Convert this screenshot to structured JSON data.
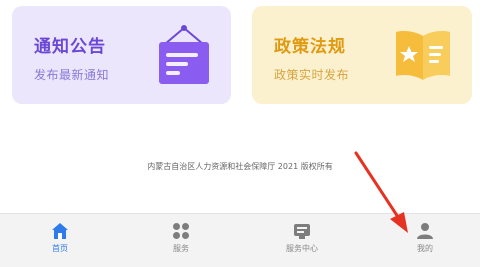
{
  "cards": [
    {
      "title": "通知公告",
      "subtitle": "发布最新通知",
      "icon": "notice-board-icon"
    },
    {
      "title": "政策法规",
      "subtitle": "政策实时发布",
      "icon": "policy-book-icon"
    }
  ],
  "footer": {
    "copyright": "内蒙古自治区人力资源和社会保障厅 2021 版权所有"
  },
  "tabbar": {
    "items": [
      {
        "label": "首页",
        "icon": "home-icon",
        "active": true
      },
      {
        "label": "服务",
        "icon": "grid-icon",
        "active": false
      },
      {
        "label": "服务中心",
        "icon": "service-center-icon",
        "active": false
      },
      {
        "label": "我的",
        "icon": "profile-icon",
        "active": false
      }
    ]
  },
  "colors": {
    "notice_bg": "#ebe6fb",
    "notice_accent": "#6b47d6",
    "policy_bg": "#fcf1cf",
    "policy_accent": "#e09a12",
    "tab_active": "#2f7bea",
    "annotation_arrow": "#e53222"
  }
}
